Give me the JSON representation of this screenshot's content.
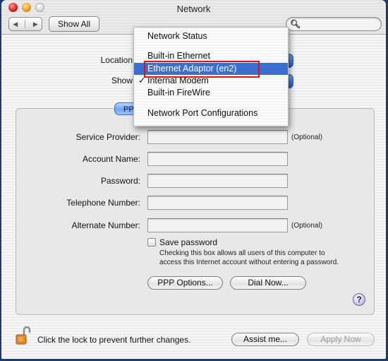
{
  "window": {
    "title": "Network"
  },
  "toolbar": {
    "back_icon": "left-arrow",
    "forward_icon": "right-arrow",
    "show_all_label": "Show All",
    "search_placeholder": "",
    "search_icon": "magnifier"
  },
  "location": {
    "label": "Location",
    "show_label": "Show"
  },
  "popup_menu": {
    "items": [
      {
        "label": "Network Status",
        "selected": false,
        "checked": false
      },
      {
        "label": "Built-in Ethernet",
        "selected": false,
        "checked": false
      },
      {
        "label": "Ethernet Adaptor (en2)",
        "selected": true,
        "checked": false
      },
      {
        "label": "Internal Modem",
        "selected": false,
        "checked": true
      },
      {
        "label": "Built-in FireWire",
        "selected": false,
        "checked": false
      },
      {
        "label": "Network Port Configurations",
        "selected": false,
        "checked": false
      }
    ],
    "check_glyph": "✓",
    "highlight_color": "#3a6fd0",
    "annotation_color": "#e0101a"
  },
  "tab": {
    "label": "PPP"
  },
  "form": {
    "fields": [
      {
        "label": "Service Provider:",
        "value": "",
        "note": "(Optional)"
      },
      {
        "label": "Account Name:",
        "value": "",
        "note": ""
      },
      {
        "label": "Password:",
        "value": "",
        "note": ""
      },
      {
        "label": "Telephone Number:",
        "value": "",
        "note": ""
      },
      {
        "label": "Alternate Number:",
        "value": "",
        "note": "(Optional)"
      }
    ],
    "save_password": {
      "label": "Save password",
      "checked": false,
      "note_line1": "Checking this box allows all users of this computer to",
      "note_line2": "access this Internet account without entering a password."
    },
    "ppp_options_label": "PPP Options...",
    "dial_now_label": "Dial Now...",
    "help_label": "?"
  },
  "footer": {
    "lock_text": "Click the lock to prevent further changes.",
    "assist_label": "Assist me...",
    "apply_label": "Apply Now",
    "apply_enabled": false
  }
}
